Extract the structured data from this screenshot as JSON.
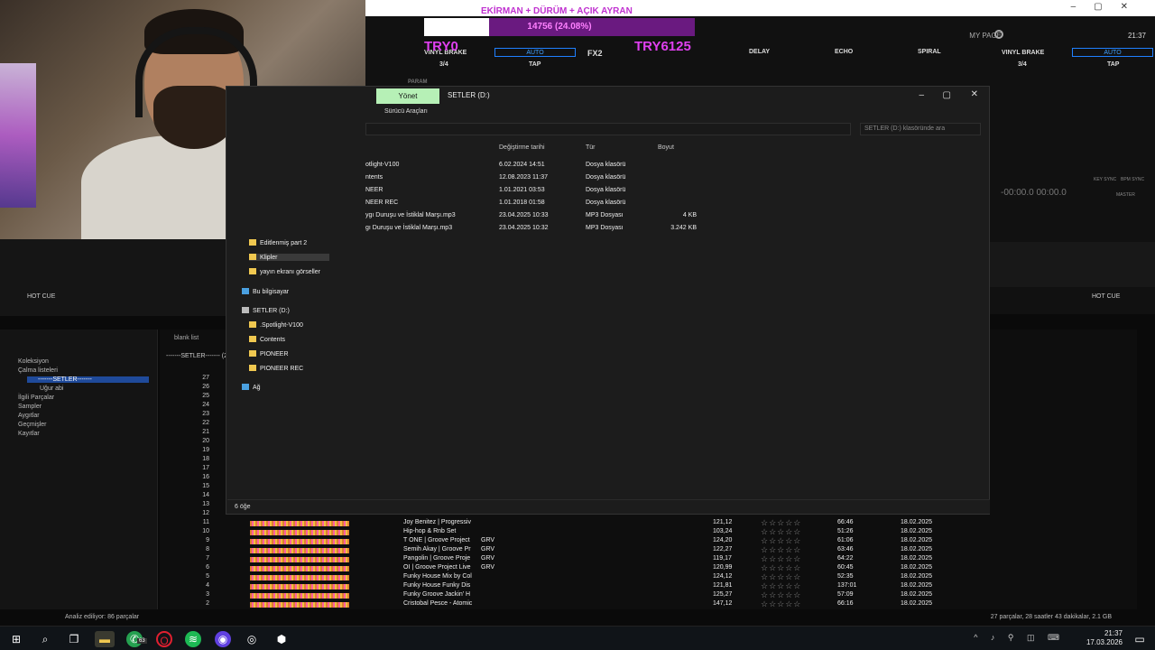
{
  "overlay": {
    "top_text": "EKİRMAN + DÜRÜM + AÇIK AYRAN",
    "progress_text": "14756 (24.08%)",
    "progress_fraction": 0.2408,
    "left_amount": "TRY0",
    "right_amount": "TRY6125"
  },
  "rekordbox": {
    "my_page": "MY PAGE",
    "clock": "21:37",
    "vinyl_brake_left": "VINYL BRAKE",
    "auto_left": "AUTO",
    "tap_left": "TAP",
    "beat_left": "3/4",
    "fx2": "FX2",
    "delay": "DELAY",
    "echo": "ECHO",
    "spiral": "SPIRAL",
    "vinyl_brake_right": "VINYL BRAKE",
    "auto_right": "AUTO",
    "tap_right": "TAP",
    "beat_right": "3/4",
    "param": "PARAM",
    "time_readout": "-00:00.0  00:00.0",
    "key_sync": "KEY SYNC",
    "bpm_sync": "BPM SYNC",
    "master": "MASTER",
    "hot_cue_left": "HOT CUE",
    "hot_cue_right": "HOT CUE",
    "blank_list": "blank list",
    "playlist_header": "-------SETLER------- (2",
    "status_left": "Analiz ediliyor: 86 parçalar",
    "status_right": "27 parçalar, 28 saatler 43 dakikalar, 2.1 GB"
  },
  "tree": [
    {
      "label": "Koleksiyon"
    },
    {
      "label": "Çalma listeleri"
    },
    {
      "label": "-------SETLER-------"
    },
    {
      "label": "Uğur abi"
    },
    {
      "label": "İlgili Parçalar"
    },
    {
      "label": "Sampler"
    },
    {
      "label": "Aygıtlar"
    },
    {
      "label": "Geçmişler"
    },
    {
      "label": "Kayıtlar"
    }
  ],
  "row_numbers": [
    "27",
    "26",
    "25",
    "24",
    "23",
    "22",
    "21",
    "20",
    "19",
    "18",
    "17",
    "16",
    "15",
    "14",
    "13",
    "12",
    "11",
    "10",
    "9",
    "8",
    "7",
    "6",
    "5",
    "4",
    "3",
    "2"
  ],
  "tracks": [
    {
      "num": "11",
      "title": "Joy Benitez | Progressiv",
      "artist": "",
      "bpm": "121,12",
      "time": "66:46",
      "date": "18.02.2025"
    },
    {
      "num": "10",
      "title": "Hip-hop & Rnb Set",
      "artist": "",
      "bpm": "103,24",
      "time": "51:26",
      "date": "18.02.2025"
    },
    {
      "num": "9",
      "title": "T ONE | Groove Project",
      "artist": "GRV",
      "bpm": "124,20",
      "time": "61:06",
      "date": "18.02.2025"
    },
    {
      "num": "8",
      "title": "Semih Akay | Groove Pr",
      "artist": "GRV",
      "bpm": "122,27",
      "time": "63:46",
      "date": "18.02.2025"
    },
    {
      "num": "7",
      "title": "Pangolin | Groove Proje",
      "artist": "GRV",
      "bpm": "119,17",
      "time": "64:22",
      "date": "18.02.2025"
    },
    {
      "num": "6",
      "title": "OI | Groove Project Live",
      "artist": "GRV",
      "bpm": "120,99",
      "time": "60:45",
      "date": "18.02.2025"
    },
    {
      "num": "5",
      "title": "Funky House Mix by Col",
      "artist": "",
      "bpm": "124,12",
      "time": "52:35",
      "date": "18.02.2025"
    },
    {
      "num": "4",
      "title": "Funky House Funky Dis",
      "artist": "",
      "bpm": "121,81",
      "time": "137:01",
      "date": "18.02.2025"
    },
    {
      "num": "3",
      "title": "Funky Groove Jackin' H",
      "artist": "",
      "bpm": "125,27",
      "time": "57:09",
      "date": "18.02.2025"
    },
    {
      "num": "2",
      "title": "Cristobal Pesce - Atomic",
      "artist": "",
      "bpm": "147,12",
      "time": "66:16",
      "date": "18.02.2025"
    }
  ],
  "explorer": {
    "tab_manage": "Yönet",
    "title": "SETLER (D:)",
    "subtitle": "Sürücü Araçları",
    "search_placeholder": "SETLER (D:) klasöründe ara",
    "columns": {
      "date": "Değiştirme tarihi",
      "type": "Tür",
      "size": "Boyut"
    },
    "files": [
      {
        "name": "otlight-V100",
        "date": "6.02.2024 14:51",
        "type": "Dosya klasörü",
        "size": ""
      },
      {
        "name": "ntents",
        "date": "12.08.2023 11:37",
        "type": "Dosya klasörü",
        "size": ""
      },
      {
        "name": "NEER",
        "date": "1.01.2021 03:53",
        "type": "Dosya klasörü",
        "size": ""
      },
      {
        "name": "NEER REC",
        "date": "1.01.2018 01:58",
        "type": "Dosya klasörü",
        "size": ""
      },
      {
        "name": "ygı Duruşu ve İstiklal Marşı.mp3",
        "date": "23.04.2025 10:33",
        "type": "MP3 Dosyası",
        "size": "4 KB"
      },
      {
        "name": "gı Duruşu ve İstiklal Marşı.mp3",
        "date": "23.04.2025 10:32",
        "type": "MP3 Dosyası",
        "size": "3.242 KB"
      }
    ],
    "nav": {
      "edited_part2": "Editlenmiş part 2",
      "klipler": "Klipler",
      "yayin": "yayın ekranı görseller",
      "this_pc": "Bu bilgisayar",
      "drive": "SETLER (D:)",
      "spotlight": ".Spotlight-V100",
      "contents": "Contents",
      "pioneer": "PIONEER",
      "pioneer_rec": "PIONEER REC",
      "network": "Ağ"
    },
    "status": "6 öğe"
  },
  "taskbar": {
    "time": "21:37",
    "date": "17.03.2026",
    "whatsapp_badge": "63"
  }
}
